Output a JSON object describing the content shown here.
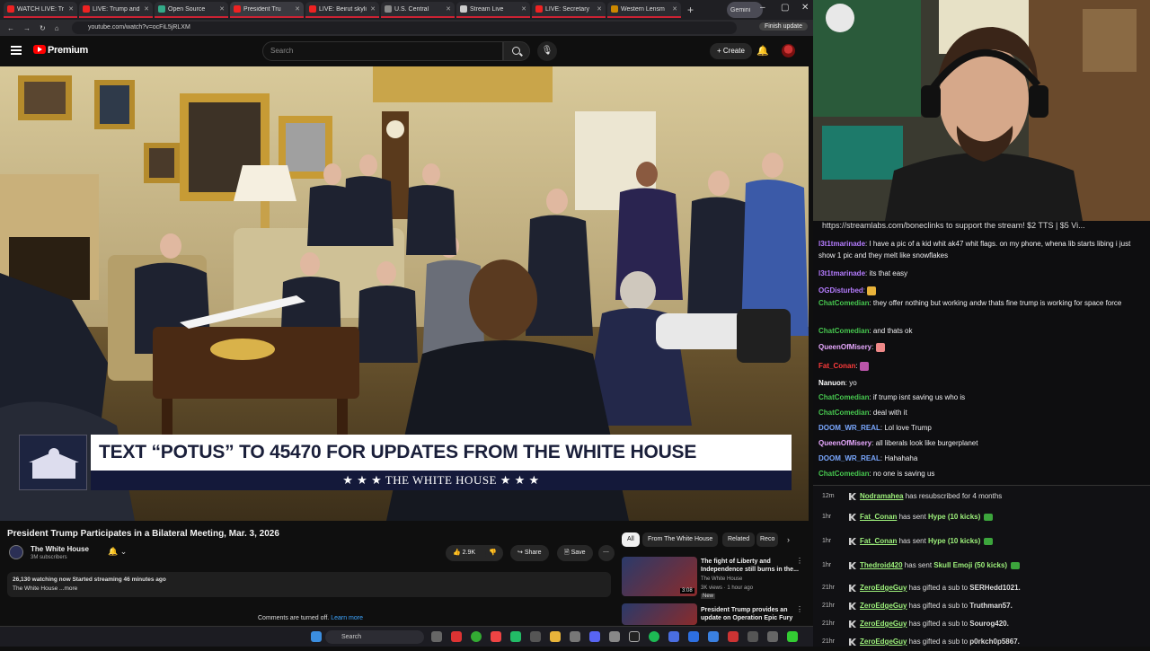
{
  "browser": {
    "tabs": [
      {
        "label": "WATCH LIVE: Tr"
      },
      {
        "label": "LIVE: Trump and"
      },
      {
        "label": "Open Source"
      },
      {
        "label": "President Tru"
      },
      {
        "label": "LIVE: Beirut skyli"
      },
      {
        "label": "U.S. Central"
      },
      {
        "label": "Stream Live"
      },
      {
        "label": "LIVE: Secretary"
      },
      {
        "label": "Western Lensm"
      }
    ],
    "gemini_label": "Gemini",
    "url": "youtube.com/watch?v=ocFiL5jRLXM",
    "finish_update": "Finish update"
  },
  "youtube": {
    "brand": "Premium",
    "search_placeholder": "Search",
    "create_label": "Create",
    "banner_text": "TEXT “POTUS” TO 45470 FOR UPDATES FROM THE WHITE HOUSE",
    "banner_sub": "★ ★ ★  THE WHITE HOUSE  ★ ★ ★",
    "video_title": "President Trump Participates in a Bilateral Meeting, Mar. 3, 2026",
    "channel_name": "The White House",
    "channel_subs": "3M subscribers",
    "likes": "2.9K",
    "share_label": "Share",
    "save_label": "Save",
    "desc_line1": "26,130 watching now  Started streaming 46 minutes ago",
    "desc_line2": "The White House ...more",
    "comments_off": "Comments are turned off.",
    "learn_more": "Learn more",
    "chips": [
      "All",
      "From The White House",
      "Related",
      "Reco"
    ],
    "related": [
      {
        "title": "The fight of Liberty and Independence still burns in the...",
        "channel": "The White House",
        "meta": "3K views · 1 hour ago",
        "badge": "New",
        "duration": "3:08"
      },
      {
        "title": "President Trump provides an update on Operation Epic Fury ...",
        "channel": "",
        "meta": "",
        "badge": "",
        "duration": ""
      }
    ]
  },
  "chat": {
    "banner": "https://streamlabs.com/boneclinks to support the stream! $2 TTS | $5 Vi...",
    "messages": [
      {
        "user": "l3t1tmarinade",
        "color": "#b57cff",
        "text": "I have a pic of a kid whit ak47 whit flags. on my phone, whena lib starts libing i just show 1 pic and they melt like snowflakes",
        "emote": ""
      },
      {
        "user": "l3t1tmarinade",
        "color": "#b57cff",
        "text": "its that easy",
        "emote": ""
      },
      {
        "user": "OGDisturbed",
        "color": "#b57cff",
        "text": "",
        "emote": "beer-emote"
      },
      {
        "user": "ChatComedian",
        "color": "#47c74f",
        "text": "they offer nothing but working andw thats fine trump is working for space force",
        "emote": ""
      },
      {
        "user": "ChatComedian",
        "color": "#47c74f",
        "text": "and thats ok",
        "emote": ""
      },
      {
        "user": "QueenOfMisery",
        "color": "#e8a9ff",
        "text": "",
        "emote": "pig-emote"
      },
      {
        "user": "Fat_Conan",
        "color": "#ff3b3b",
        "text": "",
        "emote": "emote"
      },
      {
        "user": "Nanuon",
        "color": "#ffffff",
        "text": "yo",
        "emote": ""
      },
      {
        "user": "ChatComedian",
        "color": "#47c74f",
        "text": "if trump isnt saving us who is",
        "emote": ""
      },
      {
        "user": "ChatComedian",
        "color": "#47c74f",
        "text": "deal with it",
        "emote": ""
      },
      {
        "user": "DOOM_WR_REAL",
        "color": "#7aa8ff",
        "text": "Lol love Trump",
        "emote": ""
      },
      {
        "user": "QueenOfMisery",
        "color": "#e8a9ff",
        "text": "all liberals look like burgerplanet",
        "emote": ""
      },
      {
        "user": "DOOM_WR_REAL",
        "color": "#7aa8ff",
        "text": "Hahahaha",
        "emote": ""
      },
      {
        "user": "ChatComedian",
        "color": "#47c74f",
        "text": "no one is saving us",
        "emote": ""
      }
    ]
  },
  "events": [
    {
      "time": "12m",
      "user": "Nodramahea",
      "text": " has resubscribed for 4 months",
      "extra": "",
      "kicks": false
    },
    {
      "time": "1hr",
      "user": "Fat_Conan",
      "text": " has sent ",
      "extra": "Hype (10 kicks)",
      "kicks": true
    },
    {
      "time": "1hr",
      "user": "Fat_Conan",
      "text": " has sent ",
      "extra": "Hype (10 kicks)",
      "kicks": true
    },
    {
      "time": "1hr",
      "user": "Thedroid420",
      "text": " has sent ",
      "extra": "Skull Emoji (50 kicks)",
      "kicks": true
    },
    {
      "time": "21hr",
      "user": "ZeroEdgeGuy",
      "text": " has gifted a sub to ",
      "extra": "SERHedd1021.",
      "kicks": false
    },
    {
      "time": "21hr",
      "user": "ZeroEdgeGuy",
      "text": " has gifted a sub to ",
      "extra": "Truthman57.",
      "kicks": false
    },
    {
      "time": "21hr",
      "user": "ZeroEdgeGuy",
      "text": " has gifted a sub to ",
      "extra": "Sourog420.",
      "kicks": false
    },
    {
      "time": "21hr",
      "user": "ZeroEdgeGuy",
      "text": " has gifted a sub to ",
      "extra": "p0rkch0p5867.",
      "kicks": false
    }
  ],
  "taskbar": {
    "search_placeholder": "Search"
  }
}
